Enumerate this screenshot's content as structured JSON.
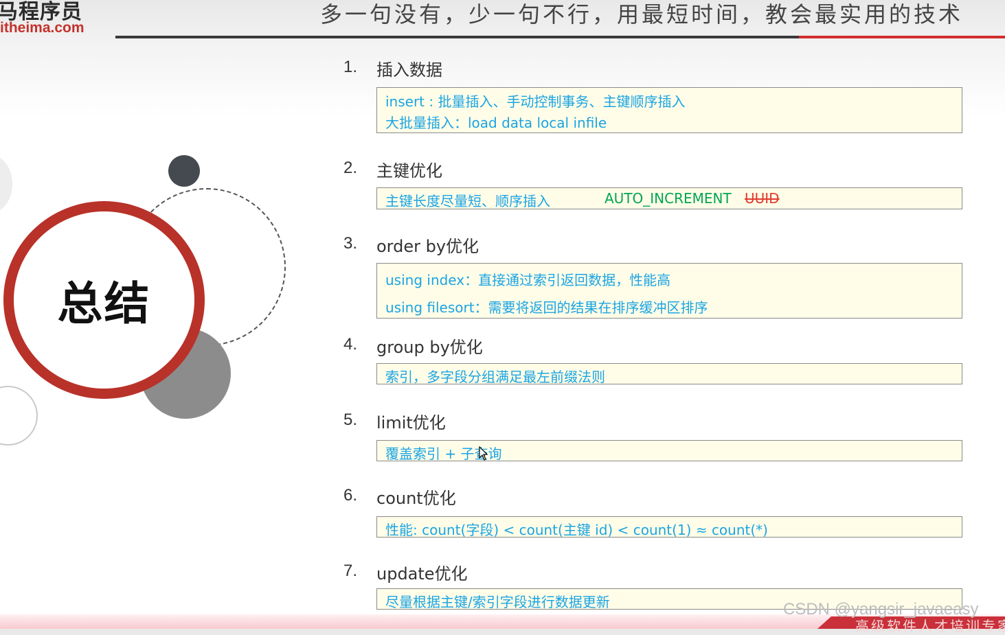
{
  "header": {
    "logo_top": "马程序员",
    "logo_bottom": "itheima.com",
    "slogan": "多一句没有，少一句不行，用最短时间，教会最实用的技术"
  },
  "summary_label": "总结",
  "items": [
    {
      "num": "1.",
      "title": "插入数据",
      "lines": [
        {
          "parts": [
            {
              "text": "insert : 批量插入、手动控制事务、主键顺序插入"
            }
          ]
        },
        {
          "parts": [
            {
              "text": "大批量插入：load  data  local  infile"
            }
          ]
        }
      ]
    },
    {
      "num": "2.",
      "title": "主键优化",
      "lines": [
        {
          "parts": [
            {
              "text": "主键长度尽量短、顺序插入"
            },
            {
              "text": "AUTO_INCREMENT",
              "style": "green"
            },
            {
              "text": "UUID",
              "style": "strike"
            }
          ]
        }
      ]
    },
    {
      "num": "3.",
      "title": "order by优化",
      "lines": [
        {
          "parts": [
            {
              "text": "using index：直接通过索引返回数据，性能高"
            }
          ]
        },
        {
          "parts": [
            {
              "text": "using filesort：需要将返回的结果在排序缓冲区排序"
            }
          ]
        }
      ]
    },
    {
      "num": "4.",
      "title": "group by优化",
      "lines": [
        {
          "parts": [
            {
              "text": "索引，多字段分组满足最左前缀法则"
            }
          ]
        }
      ]
    },
    {
      "num": "5.",
      "title": "limit优化",
      "lines": [
        {
          "parts": [
            {
              "text": "覆盖索引 + 子查询"
            }
          ]
        }
      ]
    },
    {
      "num": "6.",
      "title": "count优化",
      "lines": [
        {
          "parts": [
            {
              "text": "性能: count(字段) < count(主键 id) < count(1) ≈ count(*)"
            }
          ]
        }
      ]
    },
    {
      "num": "7.",
      "title": "update优化",
      "lines": [
        {
          "parts": [
            {
              "text": "尽量根据主键/索引字段进行数据更新"
            }
          ]
        }
      ]
    }
  ],
  "watermark": "CSDN @yangsir_javaeasy",
  "footer_banner": "高级软件人才培训专家",
  "colors": {
    "accent_red": "#b8322a",
    "text_blue": "#1ba4e3",
    "green": "#00a651",
    "strike_red": "#e23b2e",
    "box_bg": "#fffde8"
  }
}
